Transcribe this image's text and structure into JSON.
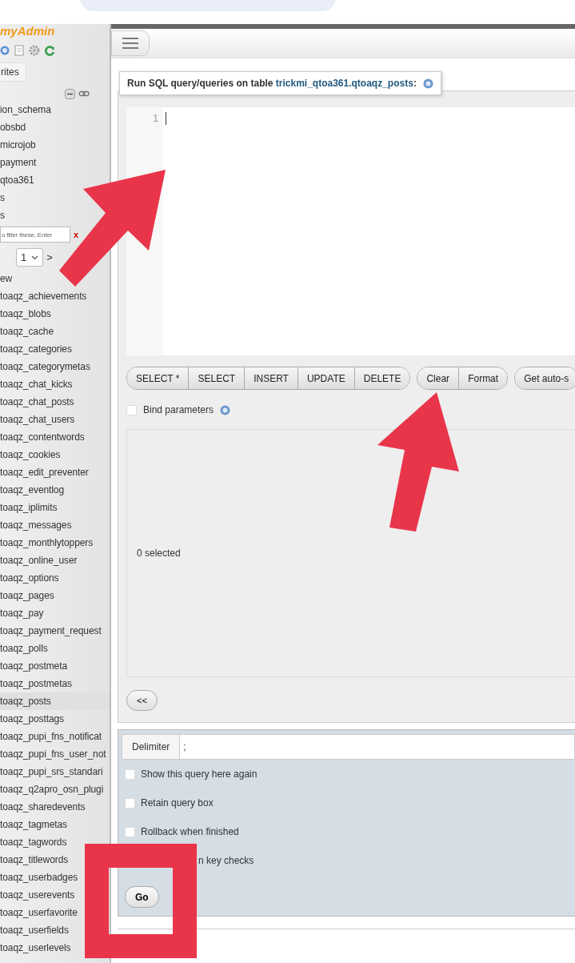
{
  "logo": {
    "text": "myAdmin"
  },
  "sidebar": {
    "tab": "rites",
    "databases": [
      "ion_schema",
      "obsbd",
      "microjob",
      "payment",
      "qtoa361",
      "s",
      "s"
    ],
    "filter": {
      "placeholder": "o filter these, Enter",
      "clear": "x"
    },
    "pager": {
      "page": "1",
      "next": ">"
    },
    "new_item": "ew",
    "tables": [
      {
        "name": "toaqz_achievements",
        "selected": false
      },
      {
        "name": "toaqz_blobs",
        "selected": false
      },
      {
        "name": "toaqz_cache",
        "selected": false
      },
      {
        "name": "toaqz_categories",
        "selected": false
      },
      {
        "name": "toaqz_categorymetas",
        "selected": false
      },
      {
        "name": "toaqz_chat_kicks",
        "selected": false
      },
      {
        "name": "toaqz_chat_posts",
        "selected": false
      },
      {
        "name": "toaqz_chat_users",
        "selected": false
      },
      {
        "name": "toaqz_contentwords",
        "selected": false
      },
      {
        "name": "toaqz_cookies",
        "selected": false
      },
      {
        "name": "toaqz_edit_preventer",
        "selected": false
      },
      {
        "name": "toaqz_eventlog",
        "selected": false
      },
      {
        "name": "toaqz_iplimits",
        "selected": false
      },
      {
        "name": "toaqz_messages",
        "selected": false
      },
      {
        "name": "toaqz_monthlytoppers",
        "selected": false
      },
      {
        "name": "toaqz_online_user",
        "selected": false
      },
      {
        "name": "toaqz_options",
        "selected": false
      },
      {
        "name": "toaqz_pages",
        "selected": false
      },
      {
        "name": "toaqz_pay",
        "selected": false
      },
      {
        "name": "toaqz_payment_request",
        "selected": false
      },
      {
        "name": "toaqz_polls",
        "selected": false
      },
      {
        "name": "toaqz_postmeta",
        "selected": false
      },
      {
        "name": "toaqz_postmetas",
        "selected": false
      },
      {
        "name": "toaqz_posts",
        "selected": true
      },
      {
        "name": "toaqz_posttags",
        "selected": false
      },
      {
        "name": "toaqz_pupi_fns_notificat",
        "selected": false
      },
      {
        "name": "toaqz_pupi_fns_user_not",
        "selected": false
      },
      {
        "name": "toaqz_pupi_srs_standari",
        "selected": false
      },
      {
        "name": "toaqz_q2apro_osn_plugi",
        "selected": false
      },
      {
        "name": "toaqz_sharedevents",
        "selected": false
      },
      {
        "name": "toaqz_tagmetas",
        "selected": false
      },
      {
        "name": "toaqz_tagwords",
        "selected": false
      },
      {
        "name": "toaqz_titlewords",
        "selected": false
      },
      {
        "name": "toaqz_userbadges",
        "selected": false
      },
      {
        "name": "toaqz_userevents",
        "selected": false
      },
      {
        "name": "toaqz_userfavorite",
        "selected": false
      },
      {
        "name": "toaqz_userfields",
        "selected": false
      },
      {
        "name": "toaqz_userlevels",
        "selected": false
      }
    ]
  },
  "query_panel": {
    "legend": "Run SQL query/queries on table ",
    "table_link": "trickmi_qtoa361.qtoaqz_posts",
    "legend_suffix": ":",
    "line_numbers": [
      "1"
    ],
    "button_groups": [
      [
        "SELECT *",
        "SELECT",
        "INSERT",
        "UPDATE",
        "DELETE"
      ],
      [
        "Clear",
        "Format"
      ],
      [
        "Get auto-s"
      ]
    ],
    "bind_parameters": {
      "label": "Bind parameters",
      "checked": false
    },
    "columns_box": {
      "count": "0 selected"
    },
    "collapse_button": "<<"
  },
  "options_panel": {
    "delimiter_label": "Delimiter",
    "delimiter_value": ";",
    "options": [
      {
        "label": "Show this query here again",
        "checked": false
      },
      {
        "label": "Retain query box",
        "checked": false
      },
      {
        "label": "Rollback when finished",
        "checked": false
      }
    ],
    "covered_option": "n key checks",
    "go_button": "Go"
  },
  "annotations": [
    {
      "kind": "arrow"
    },
    {
      "kind": "arrow"
    },
    {
      "kind": "frame"
    }
  ]
}
